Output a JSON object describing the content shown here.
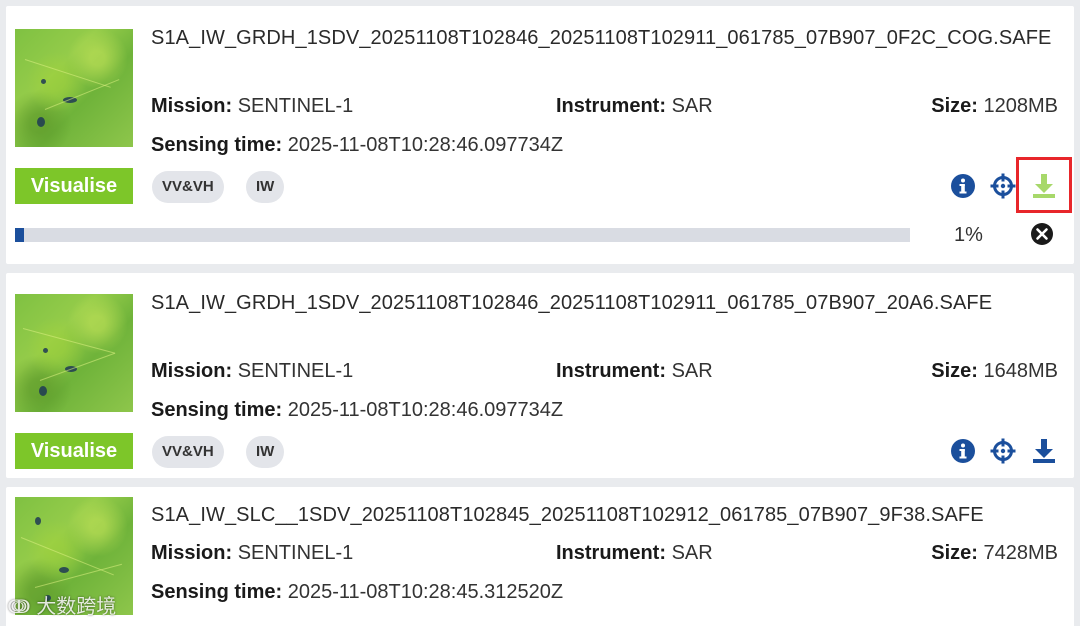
{
  "labels": {
    "mission": "Mission:",
    "instrument": "Instrument:",
    "size": "Size:",
    "sensing_time": "Sensing time:",
    "visualise": "Visualise"
  },
  "products": [
    {
      "title": "S1A_IW_GRDH_1SDV_20251108T102846_20251108T102911_061785_07B907_0F2C_COG.SAFE",
      "mission": "SENTINEL-1",
      "instrument": "SAR",
      "size": "1208MB",
      "sensing_time": "2025-11-08T10:28:46.097734Z",
      "badges": [
        "VV&VH",
        "IW"
      ],
      "download_progress": {
        "fraction": 0.01,
        "text": "1%"
      }
    },
    {
      "title": "S1A_IW_GRDH_1SDV_20251108T102846_20251108T102911_061785_07B907_20A6.SAFE",
      "mission": "SENTINEL-1",
      "instrument": "SAR",
      "size": "1648MB",
      "sensing_time": "2025-11-08T10:28:46.097734Z",
      "badges": [
        "VV&VH",
        "IW"
      ]
    },
    {
      "title": "S1A_IW_SLC__1SDV_20251108T102845_20251108T102912_061785_07B907_9F38.SAFE",
      "mission": "SENTINEL-1",
      "instrument": "SAR",
      "size": "7428MB",
      "sensing_time": "2025-11-08T10:28:45.312520Z"
    }
  ],
  "icons": {
    "info": "info-icon",
    "locate": "crosshair-icon",
    "download": "download-icon",
    "cancel": "cancel-icon"
  },
  "colors": {
    "accent_green": "#7dc629",
    "icon_blue": "#1b4f9c",
    "download_active_green": "#a7d86a",
    "highlight_red": "#e8262a"
  },
  "watermark": "大数跨境"
}
